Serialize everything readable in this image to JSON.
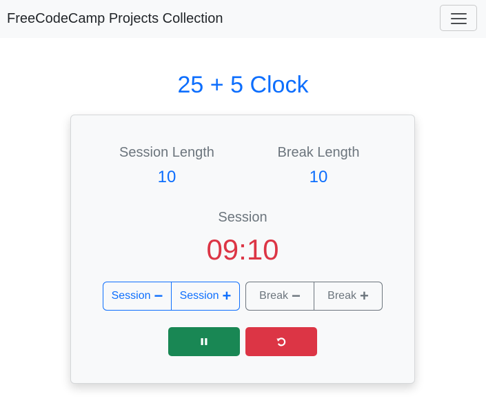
{
  "navbar": {
    "brand": "FreeCodeCamp Projects Collection",
    "toggler_icon": "hamburger-icon"
  },
  "page": {
    "title": "25 + 5 Clock"
  },
  "clock": {
    "session_length_label": "Session Length",
    "session_length_value": "10",
    "break_length_label": "Break Length",
    "break_length_value": "10",
    "timer_label": "Session",
    "timer_value": "09:10"
  },
  "controls": {
    "session_decrement_label": "Session",
    "session_increment_label": "Session",
    "break_decrement_label": "Break",
    "break_increment_label": "Break",
    "minus_symbol": "−",
    "plus_symbol": "+",
    "play_pause_icon": "pause-icon",
    "reset_icon": "reset-icon"
  },
  "colors": {
    "primary": "#0d6efd",
    "danger": "#dc3545",
    "success": "#198754",
    "secondary": "#6c757d",
    "navbar_bg": "#f8f9fa"
  }
}
